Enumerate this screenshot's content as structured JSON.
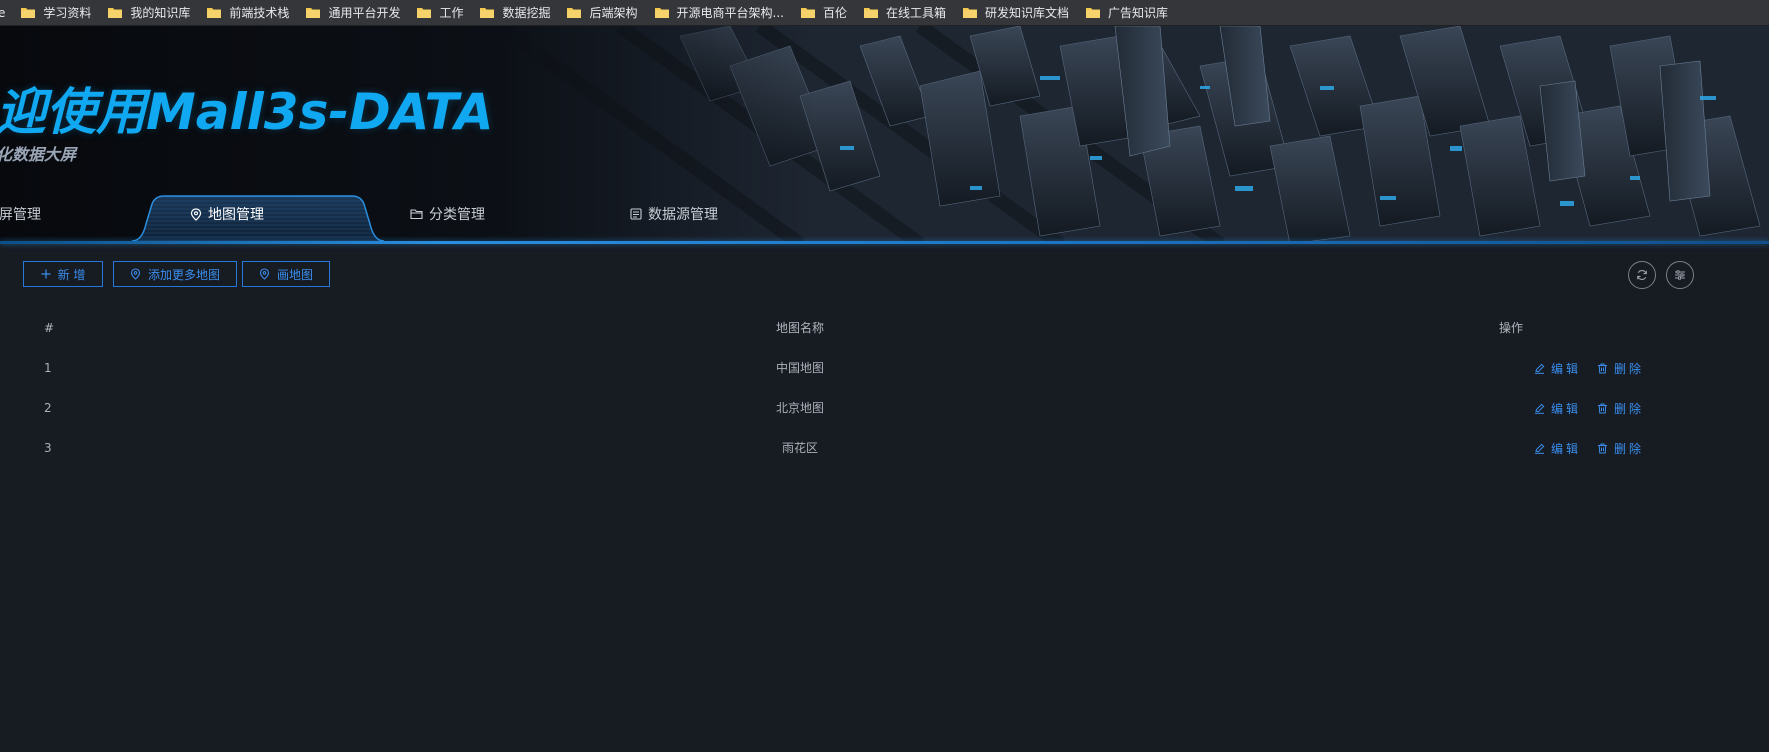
{
  "bookmarks": {
    "lead_text": "e",
    "items": [
      "学习资料",
      "我的知识库",
      "前端技术栈",
      "通用平台开发",
      "工作",
      "数据挖掘",
      "后端架构",
      "开源电商平台架构...",
      "百伦",
      "在线工具箱",
      "研发知识库文档",
      "广告知识库"
    ]
  },
  "header": {
    "title": "迎使用Mall3s-DATA",
    "subtitle": "化数据大屏"
  },
  "tabs": [
    {
      "label": "屏管理",
      "icon": "none"
    },
    {
      "label": "地图管理",
      "icon": "map-pin-icon",
      "active": true
    },
    {
      "label": "分类管理",
      "icon": "folder-icon"
    },
    {
      "label": "数据源管理",
      "icon": "database-icon"
    }
  ],
  "toolbar": {
    "add_label": "新 增",
    "add_more_label": "添加更多地图",
    "draw_label": "画地图"
  },
  "table": {
    "headers": {
      "index": "#",
      "name": "地图名称",
      "ops": "操作"
    },
    "rows": [
      {
        "index": "1",
        "name": "中国地图"
      },
      {
        "index": "2",
        "name": "北京地图"
      },
      {
        "index": "3",
        "name": "雨花区"
      }
    ],
    "edit_label": "编辑",
    "delete_label": "删除"
  },
  "colors": {
    "accent": "#3a8ff0",
    "title": "#11a8f2",
    "background": "#171b22"
  }
}
